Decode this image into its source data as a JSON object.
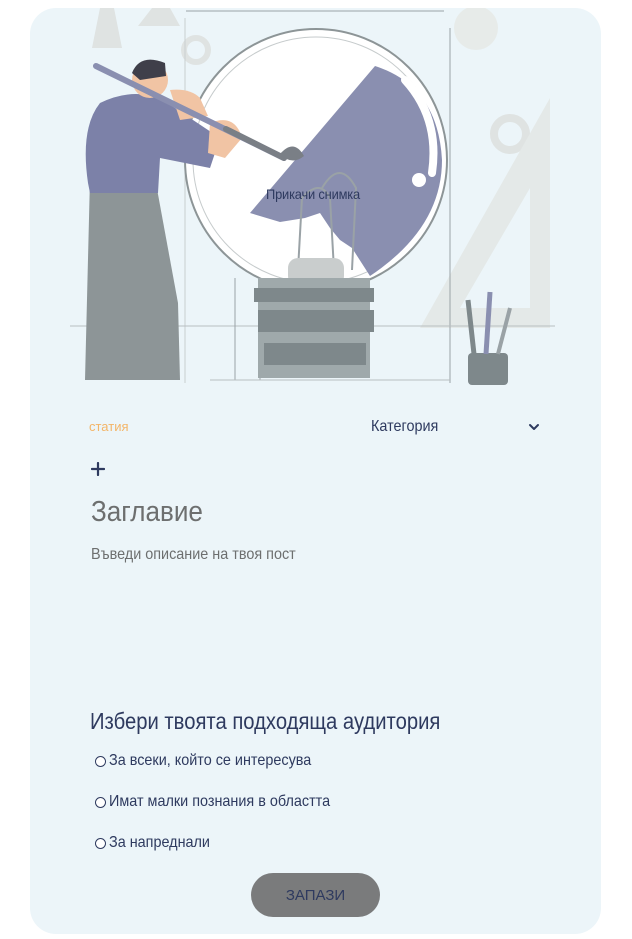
{
  "hero": {
    "attach_label": "Прикачи снимка",
    "illustration_icon": "designer-lightbulb-illustration"
  },
  "form": {
    "type_tag": "статия",
    "category_placeholder": "Категория",
    "add_icon": "plus-icon",
    "title_placeholder": "Заглавие",
    "description_placeholder": "Въведи описание на твоя пост"
  },
  "audience": {
    "heading": "Избери твоята подходяща аудитория",
    "options": [
      "За всеки, който се интересува",
      "Имат малки познания в областта",
      "За напреднали"
    ]
  },
  "actions": {
    "save_label": "ЗАПАЗИ"
  },
  "colors": {
    "card_background": "#ecf5f9",
    "primary_text": "#2e3a5f",
    "accent_tag": "#f3b568",
    "save_button": "#7a7b7c",
    "illustration_purple": "#8a8fb0"
  }
}
